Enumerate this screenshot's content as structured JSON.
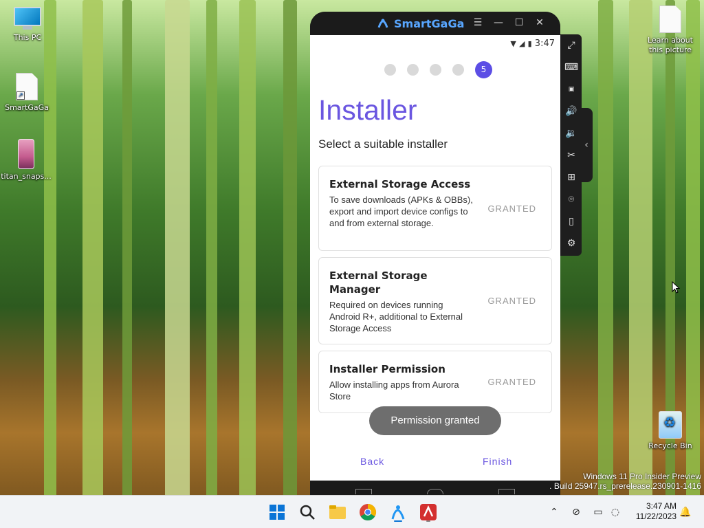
{
  "desktop": {
    "icons": [
      {
        "label": "This PC",
        "type": "monitor"
      },
      {
        "label": "SmartGaGa",
        "type": "shortcut"
      },
      {
        "label": "titan_snaps...",
        "type": "image"
      },
      {
        "label": "Learn about this picture",
        "type": "file"
      },
      {
        "label": "Recycle Bin",
        "type": "recycle"
      }
    ]
  },
  "emulator": {
    "brand": "SmartGaGa",
    "window_buttons": [
      "menu-icon",
      "minimize-icon",
      "maximize-icon",
      "close-icon"
    ],
    "status_time": "3:47",
    "status_icons": [
      "wifi-icon",
      "signal-icon",
      "battery-icon"
    ],
    "steps": {
      "total": 5,
      "current": "5"
    },
    "title": "Installer",
    "subtitle": "Select a suitable installer",
    "cards": [
      {
        "title": "External Storage Access",
        "description": "To save downloads (APKs & OBBs), export and import device configs to and from external storage.",
        "state": "GRANTED"
      },
      {
        "title": "External Storage Manager",
        "description": "Required on devices running Android R+, additional to External Storage Access",
        "state": "GRANTED"
      },
      {
        "title": "Installer Permission",
        "description": "Allow installing apps from Aurora Store",
        "state": "GRANTED"
      }
    ],
    "toast": "Permission granted",
    "back_label": "Back",
    "finish_label": "Finish",
    "sidebar_tools": [
      "fullscreen-icon",
      "keyboard-icon",
      "apk-install-icon",
      "volume-up-icon",
      "volume-down-icon",
      "screenshot-scissors-icon",
      "add-window-icon",
      "location-icon",
      "shake-icon",
      "settings-icon"
    ]
  },
  "watermark": {
    "line1": "Windows 11 Pro Insider Preview",
    "line2": ". Build 25947.rs_prerelease.230901-1416"
  },
  "taskbar": {
    "apps": [
      "start-icon",
      "search-icon",
      "file-explorer-icon",
      "chrome-icon",
      "smartgaga-icon",
      "avira-icon"
    ],
    "tray": [
      "chevron-up-icon",
      "network-off-icon",
      "display-icon",
      "wifi-off-icon"
    ],
    "time": "3:47 AM",
    "date": "11/22/2023",
    "notification": "bell-icon"
  },
  "colors": {
    "accent": "#6a56e0",
    "granted": "#9a9a9a",
    "taskbar": "#f1f3f6"
  }
}
